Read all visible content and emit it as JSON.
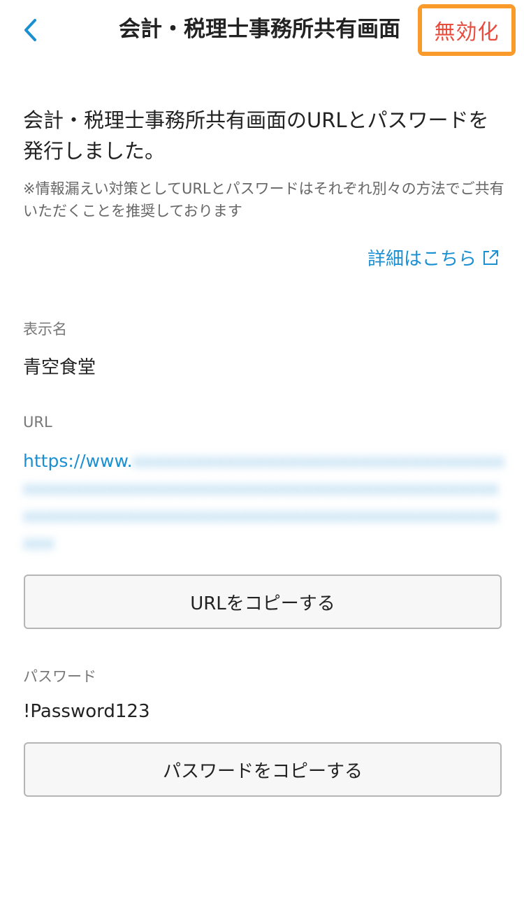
{
  "header": {
    "back_icon": "chevron-left-icon",
    "title": "会計・税理士事務所共有画面",
    "disable_label": "無効化",
    "disable_highlight_color": "#f99a2a",
    "disable_text_color": "#e84c3d"
  },
  "intro": {
    "message": "会計・税理士事務所共有画面のURLとパスワードを発行しました。",
    "note": "※情報漏えい対策としてURLとパスワードはそれぞれ別々の方法でご共有いただくことを推奨しております",
    "details_link": "詳細はこちら",
    "details_icon": "external-link-icon",
    "link_color": "#1a8fd1"
  },
  "display_name": {
    "label": "表示名",
    "value": "青空食堂"
  },
  "url": {
    "label": "URL",
    "visible_prefix": "https://www.",
    "copy_button": "URLをコピーする"
  },
  "password": {
    "label": "パスワード",
    "value": "!Password123",
    "copy_button": "パスワードをコピーする"
  }
}
